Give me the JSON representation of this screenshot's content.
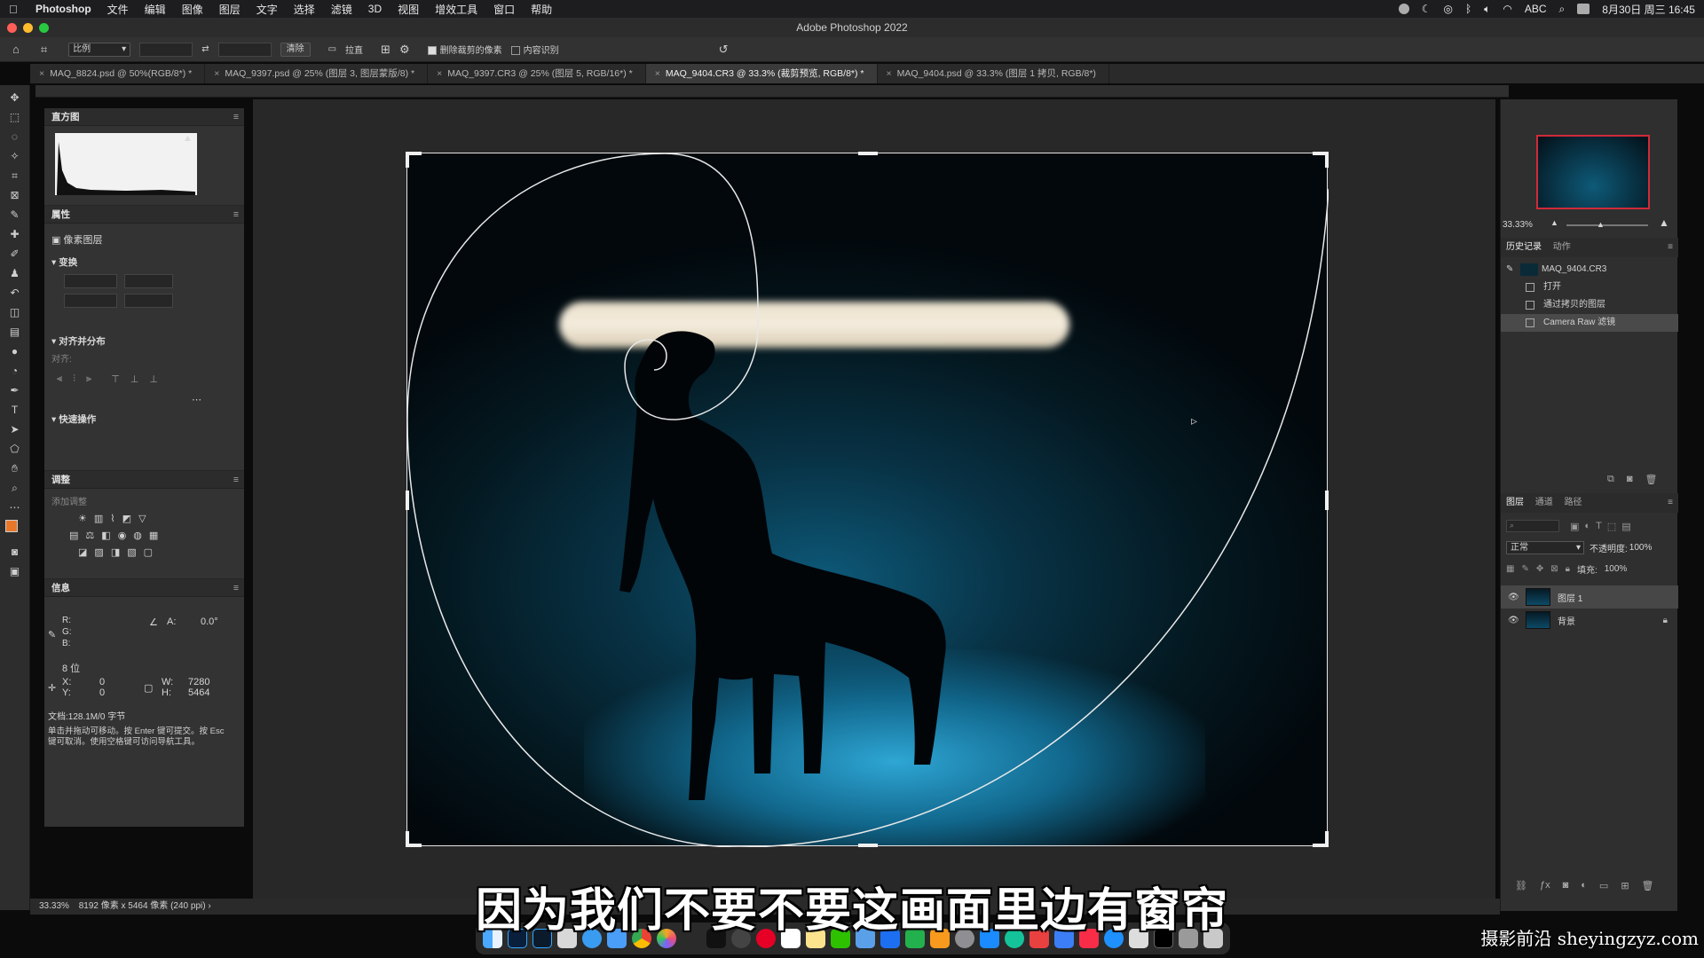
{
  "menubar": {
    "app_name": "Photoshop",
    "items": [
      "文件",
      "编辑",
      "图像",
      "图层",
      "文字",
      "选择",
      "滤镜",
      "3D",
      "视图",
      "增效工具",
      "窗口",
      "帮助"
    ],
    "input_method": "ABC",
    "datetime": "8月30日 周三 16:45"
  },
  "window": {
    "title": "Adobe Photoshop 2022"
  },
  "options_bar": {
    "ratio_select": "比例",
    "clear_label": "清除",
    "straighten_label": "拉直",
    "delete_cropped_label": "删除裁剪的像素",
    "content_aware_label": "内容识别"
  },
  "tabs": [
    {
      "label": "MAQ_8824.psd @ 50%(RGB/8*) *"
    },
    {
      "label": "MAQ_9397.psd @ 25% (图层 3, 图层蒙版/8) *"
    },
    {
      "label": "MAQ_9397.CR3 @ 25% (图层 5, RGB/16*) *"
    },
    {
      "label": "MAQ_9404.CR3 @ 33.3% (裁剪预览, RGB/8*) *"
    },
    {
      "label": "MAQ_9404.psd @ 33.3% (图层 1 拷贝, RGB/8*)"
    }
  ],
  "left": {
    "histogram_title": "直方图",
    "properties_title": "属性",
    "pixel_layer_label": "像素图层",
    "transform_label": "变换",
    "align_label": "对齐并分布",
    "align_sub": "对齐:",
    "quick_actions_label": "快速操作",
    "adjustments_title": "调整",
    "add_adjustment_label": "添加调整",
    "info_title": "信息",
    "info": {
      "r_label": "R:",
      "g_label": "G:",
      "b_label": "B:",
      "a_label": "A:",
      "a_value": "0.0°",
      "bit_label": "8 位",
      "x_label": "X:",
      "x_value": "0",
      "y_label": "Y:",
      "y_value": "0",
      "w_label": "W:",
      "w_value": "7280",
      "h_label": "H:",
      "h_value": "5464",
      "doc_label": "文档:128.1M/0 字节",
      "hint_line1": "单击并拖动可移动。按 Enter 键可提交。按 Esc",
      "hint_line2": "键可取消。使用空格键可访问导航工具。"
    }
  },
  "right": {
    "zoom_value": "33.33%",
    "history_tab": "历史记录",
    "actions_tab": "动作",
    "history_source": "MAQ_9404.CR3",
    "history_items": [
      "打开",
      "通过拷贝的图层",
      "Camera Raw 滤镜"
    ],
    "layers_tab": "图层",
    "channels_tab": "通道",
    "paths_tab": "路径",
    "blend_mode": "正常",
    "opacity_label": "不透明度:",
    "opacity_value": "100%",
    "fill_label": "填充:",
    "fill_value": "100%",
    "layers": [
      {
        "name": "图层 1",
        "selected": true
      },
      {
        "name": "背景",
        "selected": false
      }
    ]
  },
  "status": {
    "zoom": "33.33%",
    "doc_size": "8192 像素 x 5464 像素 (240 ppi)"
  },
  "subtitle": "因为我们不要不要这画面里边有窗帘",
  "watermark": "摄影前沿 sheyingzyz.com",
  "colors": {
    "accent_red": "#d02a3a",
    "foreground_swatch": "#e8772a",
    "photo_glow": "#2ea6d4"
  }
}
